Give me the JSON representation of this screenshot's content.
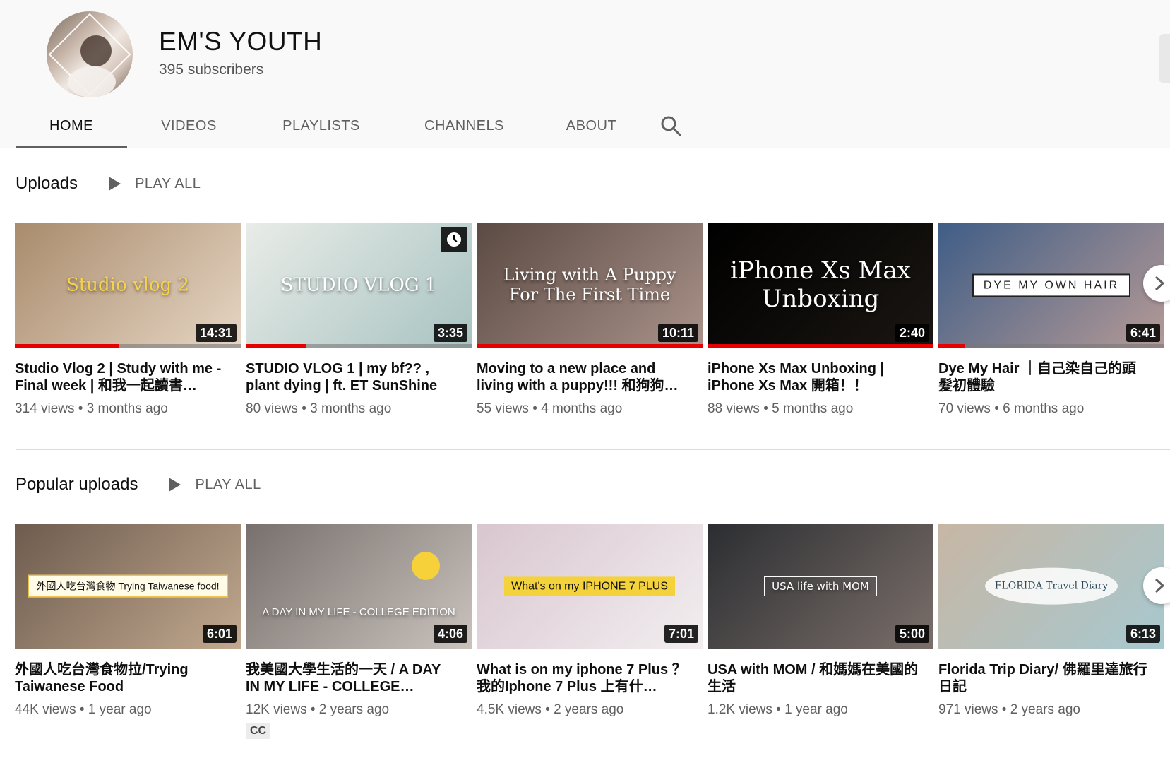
{
  "channel": {
    "name": "EM'S YOUTH",
    "subscribers": "395 subscribers"
  },
  "tabs": [
    {
      "label": "HOME",
      "active": true
    },
    {
      "label": "VIDEOS",
      "active": false
    },
    {
      "label": "PLAYLISTS",
      "active": false
    },
    {
      "label": "CHANNELS",
      "active": false
    },
    {
      "label": "ABOUT",
      "active": false
    }
  ],
  "uploads": {
    "title": "Uploads",
    "play_all": "PLAY ALL",
    "videos": [
      {
        "thumb_text": "Studio vlog 2",
        "duration": "14:31",
        "progress": 0.46,
        "title": "Studio Vlog 2 | Study with me - Final week | 和我一起讀書…",
        "meta": "314 views • 3 months ago",
        "colors": [
          "#a98b6c",
          "#e6d6c4"
        ]
      },
      {
        "thumb_text": "STUDIO VLOG 1",
        "duration": "3:35",
        "progress": 0.27,
        "title": "STUDIO VLOG 1 | my bf?? , plant dying | ft. ET SunShine",
        "meta": "80 views • 3 months ago",
        "colors": [
          "#e9ece8",
          "#a8c3c1"
        ]
      },
      {
        "thumb_text": "Living with A Puppy For The First Time",
        "duration": "10:11",
        "progress": 1.0,
        "title": "Moving to a new place and living with a puppy!!! 和狗狗…",
        "meta": "55 views • 4 months ago",
        "colors": [
          "#5b4a43",
          "#a9928a"
        ]
      },
      {
        "thumb_text": "iPhone Xs Max Unboxing",
        "duration": "2:40",
        "progress": 1.0,
        "title": "iPhone Xs Max Unboxing | iPhone Xs Max 開箱！！",
        "meta": "88 views • 5 months ago",
        "colors": [
          "#000000",
          "#1a1612"
        ]
      },
      {
        "thumb_text": "DYE MY OWN HAIR",
        "duration": "6:41",
        "progress": 0.12,
        "title": "Dye My Hair ｜自己染自己的頭髮初體驗",
        "meta": "70 views • 6 months ago",
        "colors": [
          "#3f5d86",
          "#b59a96"
        ]
      }
    ]
  },
  "popular": {
    "title": "Popular uploads",
    "play_all": "PLAY ALL",
    "videos": [
      {
        "thumb_text": "外國人吃台灣食物 Trying Taiwanese food!",
        "duration": "6:01",
        "title": "外國人吃台灣食物拉/Trying Taiwanese Food",
        "meta": "44K views • 1 year ago",
        "cc": "",
        "colors": [
          "#6d5b4e",
          "#c2a98f"
        ]
      },
      {
        "thumb_text": "A DAY IN MY LIFE - COLLEGE EDITION",
        "duration": "4:06",
        "title": "我美國大學生活的一天 / A DAY IN MY LIFE - COLLEGE…",
        "meta": "12K views • 2 years ago",
        "cc": "CC",
        "colors": [
          "#77706c",
          "#c9c2bd"
        ]
      },
      {
        "thumb_text": "What's on my IPHONE 7 PLUS",
        "duration": "7:01",
        "title": "What is on my iphone 7 Plus ？ 我的Iphone 7 Plus 上有什…",
        "meta": "4.5K views • 2 years ago",
        "cc": "",
        "colors": [
          "#d9c6cf",
          "#f2eef0"
        ]
      },
      {
        "thumb_text": "USA life with MOM",
        "duration": "5:00",
        "title": "USA with MOM / 和媽媽在美國的生活",
        "meta": "1.2K views • 1 year ago",
        "cc": "",
        "colors": [
          "#2b2d31",
          "#7b6f6a"
        ]
      },
      {
        "thumb_text": "FLORIDA Travel Diary",
        "duration": "6:13",
        "title": "Florida Trip Diary/ 佛羅里達旅行日記",
        "meta": "971 views • 2 years ago",
        "cc": "",
        "colors": [
          "#c7b6a4",
          "#a7c8cf"
        ]
      }
    ]
  }
}
